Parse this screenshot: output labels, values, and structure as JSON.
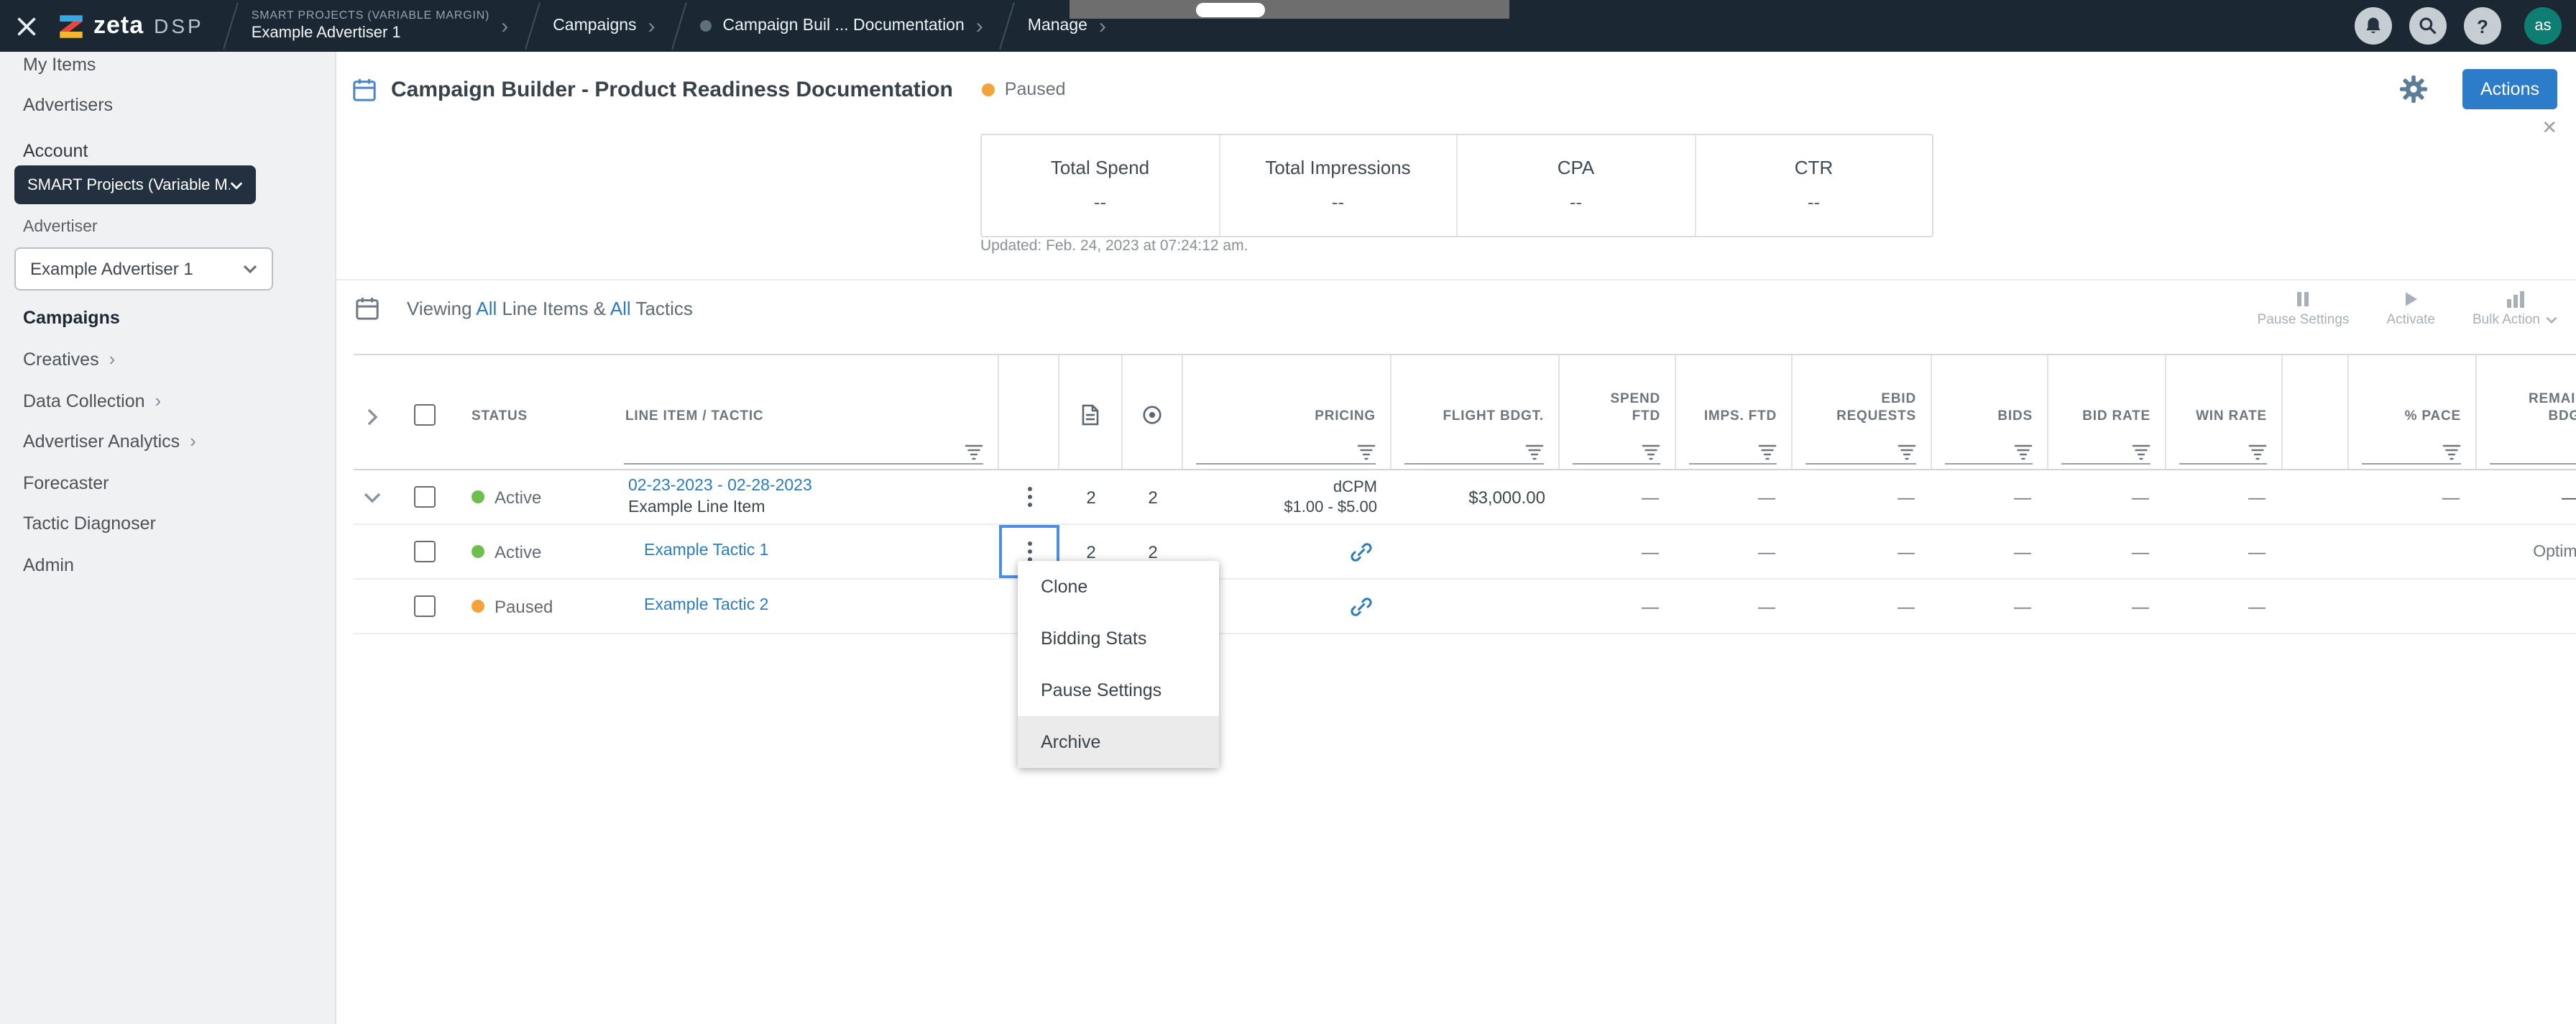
{
  "colors": {
    "topbar_bg": "#1b2733",
    "accent_blue": "#2d7cc9",
    "link_blue": "#2b7bbd",
    "active_green": "#6fbf4e",
    "paused_orange": "#f2a33c",
    "sidebar_bg": "#f0f1f2",
    "account_button_bg": "#22303f"
  },
  "icons": {
    "chevron": "›",
    "help": "?",
    "close": "✕",
    "menu_close": "✕ (close/collapse)",
    "kebab": "⋮ three-dot row menu",
    "bell": "bell-icon",
    "search": "magnifier-icon",
    "gear": "gear-icon",
    "calendar": "calendar-icon",
    "filter": "filter-lines-icon",
    "file": "document-icon",
    "target": "target-icon",
    "link": "chain-link-icon",
    "play": "play-triangle-icon",
    "pause": "pause-bars-icon",
    "chart": "bar-chart-icon"
  },
  "topbar": {
    "brand": "zeta",
    "product": "DSP",
    "breadcrumb": {
      "project": "SMART PROJECTS (VARIABLE MARGIN)",
      "advertiser": "Example Advertiser 1",
      "campaigns": "Campaigns",
      "campaign": "Campaign Buil ... Documentation",
      "manage": "Manage"
    },
    "avatar_initials": "as"
  },
  "sidebar": {
    "my_items": "My Items",
    "advertisers": "Advertisers",
    "account_label": "Account",
    "account_value": "SMART Projects (Variable M...",
    "advertiser_label": "Advertiser",
    "advertiser_value": "Example Advertiser 1",
    "campaigns": "Campaigns",
    "creatives": "Creatives",
    "data_collection": "Data Collection",
    "advertiser_analytics": "Advertiser Analytics",
    "forecaster": "Forecaster",
    "tactic_diagnoser": "Tactic Diagnoser",
    "admin": "Admin"
  },
  "header": {
    "title": "Campaign Builder - Product Readiness Documentation",
    "status": "Paused",
    "actions_label": "Actions",
    "close": "✕"
  },
  "stats": {
    "metrics": [
      {
        "label": "Total Spend",
        "value": "--"
      },
      {
        "label": "Total Impressions",
        "value": "--"
      },
      {
        "label": "CPA",
        "value": "--"
      },
      {
        "label": "CTR",
        "value": "--"
      }
    ],
    "updated": "Updated: Feb. 24, 2023 at 07:24:12 am."
  },
  "toolbar": {
    "viewing": "Viewing ",
    "all1": "All",
    "line_items": " Line Items & ",
    "all2": "All",
    "tactics": " Tactics",
    "pause_settings": "Pause Settings",
    "activate": "Activate",
    "bulk_action": "Bulk Action"
  },
  "table": {
    "headers": {
      "status": "STATUS",
      "line_item": "LINE ITEM / TACTIC",
      "pricing": "PRICING",
      "flight": "FLIGHT BDGT.",
      "spend_l1": "SPEND",
      "spend_l2": "FTD",
      "imps": "IMPS. FTD",
      "ebid_l1": "EBID",
      "ebid_l2": "REQUESTS",
      "bids": "BIDS",
      "bid_rate": "BID RATE",
      "win_rate": "WIN RATE",
      "pace": "% PACE",
      "rem_l1": "REMAINING",
      "rem_l2": "BDGT."
    },
    "rows": [
      {
        "status": "Active",
        "period": "02-23-2023 - 02-28-2023",
        "name": "Example Line Item",
        "files": "2",
        "targets": "2",
        "pricing_type": "dCPM",
        "pricing_range": "$1.00 - $5.00",
        "flight": "$3,000.00",
        "spend": "—",
        "imps": "—",
        "ebid": "—",
        "bids": "—",
        "bid_rate": "—",
        "win_rate": "—",
        "pace": "—",
        "rem": "—"
      },
      {
        "status": "Active",
        "name": "Example Tactic 1",
        "files": "2",
        "targets": "2",
        "spend": "—",
        "imps": "—",
        "ebid": "—",
        "bids": "—",
        "bid_rate": "—",
        "win_rate": "—",
        "rem": "Optimized"
      },
      {
        "status": "Paused",
        "name": "Example Tactic 2",
        "spend": "—",
        "imps": "—",
        "ebid": "—",
        "bids": "—",
        "bid_rate": "—",
        "win_rate": "—"
      }
    ]
  },
  "menu": {
    "items": [
      "Clone",
      "Bidding Stats",
      "Pause Settings",
      "Archive"
    ]
  }
}
